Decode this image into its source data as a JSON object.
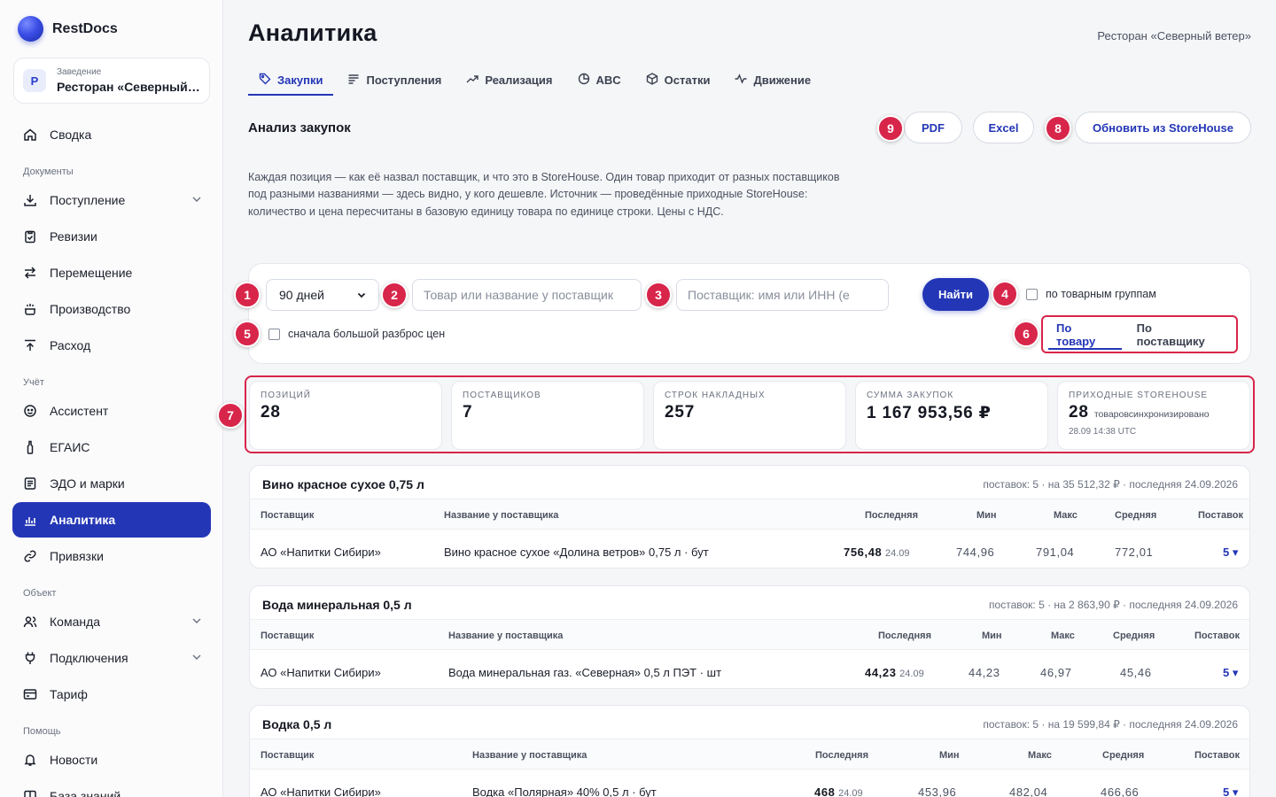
{
  "app": {
    "name": "RestDocs"
  },
  "venue": {
    "label": "Заведение",
    "name": "Ресторан «Северный ветер»",
    "avatar": "Р"
  },
  "sidebar": {
    "items": [
      {
        "label": "Сводка",
        "icon": "home-icon"
      },
      {
        "section": "Документы"
      },
      {
        "label": "Поступление",
        "icon": "download-icon",
        "expandable": true
      },
      {
        "label": "Ревизии",
        "icon": "clipboard-icon"
      },
      {
        "label": "Перемещение",
        "icon": "transfer-icon"
      },
      {
        "label": "Производство",
        "icon": "pot-icon"
      },
      {
        "label": "Расход",
        "icon": "upload-icon"
      },
      {
        "section": "Учёт"
      },
      {
        "label": "Ассистент",
        "icon": "assistant-icon"
      },
      {
        "label": "ЕГАИС",
        "icon": "bottle-icon"
      },
      {
        "label": "ЭДО и марки",
        "icon": "document-icon"
      },
      {
        "label": "Аналитика",
        "icon": "chart-icon",
        "active": true
      },
      {
        "label": "Привязки",
        "icon": "link-icon"
      },
      {
        "section": "Объект"
      },
      {
        "label": "Команда",
        "icon": "users-icon",
        "expandable": true
      },
      {
        "label": "Подключения",
        "icon": "plug-icon",
        "expandable": true
      },
      {
        "label": "Тариф",
        "icon": "card-icon"
      },
      {
        "section": "Помощь"
      },
      {
        "label": "Новости",
        "icon": "bell-icon"
      },
      {
        "label": "База знаний",
        "icon": "book-icon"
      }
    ]
  },
  "header": {
    "title": "Аналитика",
    "venue": "Ресторан «Северный ветер»"
  },
  "tabs": [
    {
      "label": "Закупки",
      "icon": "tag-icon",
      "active": true
    },
    {
      "label": "Поступления",
      "icon": "list-icon"
    },
    {
      "label": "Реализация",
      "icon": "trend-icon"
    },
    {
      "label": "ABC",
      "icon": "pie-icon"
    },
    {
      "label": "Остатки",
      "icon": "box-icon"
    },
    {
      "label": "Движение",
      "icon": "pulse-icon"
    }
  ],
  "section": {
    "title": "Анализ закупок",
    "pdf": "PDF",
    "excel": "Excel",
    "refresh": "Обновить из StoreHouse",
    "description": "Каждая позиция — как её назвал поставщик, и что это в StoreHouse. Один товар приходит от разных поставщиков под разными названиями — здесь видно, у кого дешевле. Источник — проведённые приходные StoreHouse: количество и цена пересчитаны в базовую единицу товара по единице строки. Цены с НДС."
  },
  "filters": {
    "period": "90 дней",
    "product_placeholder": "Товар или название у поставщик",
    "supplier_placeholder": "Поставщик: имя или ИНН (е",
    "find": "Найти",
    "by_groups": "по товарным группам",
    "spread_first": "сначала большой разброс цен",
    "view_by_product": "По товару",
    "view_by_supplier": "По поставщику"
  },
  "badges": [
    "1",
    "2",
    "3",
    "4",
    "5",
    "6",
    "7",
    "8",
    "9"
  ],
  "kpis": [
    {
      "label": "Позиций",
      "value": "28"
    },
    {
      "label": "Поставщиков",
      "value": "7"
    },
    {
      "label": "Строк накладных",
      "value": "257"
    },
    {
      "label": "Сумма закупок",
      "value": "1 167 953,56 ₽"
    },
    {
      "label": "Приходные StoreHouse",
      "value": "28",
      "suffix": "товаровсинхронизировано",
      "time": "28.09 14:38 UTC"
    }
  ],
  "columns": {
    "supplier": "Поставщик",
    "name": "Название у поставщика",
    "last": "Последняя",
    "min": "Мин",
    "max": "Макс",
    "avg": "Средняя",
    "deliveries": "Поставок"
  },
  "products": [
    {
      "title": "Вино красное сухое 0,75 л",
      "meta": "поставок: 5 · на 35 512,32 ₽ · последняя 24.09.2026",
      "row": {
        "supplier": "АО «Напитки Сибири»",
        "name": "Вино красное сухое «Долина ветров» 0,75 л · бут",
        "last": "756,48",
        "last_date": "24.09",
        "min": "744,96",
        "max": "791,04",
        "avg": "772,01",
        "count": "5 ▾"
      }
    },
    {
      "title": "Вода минеральная 0,5 л",
      "meta": "поставок: 5 · на 2 863,90 ₽ · последняя 24.09.2026",
      "row": {
        "supplier": "АО «Напитки Сибири»",
        "name": "Вода минеральная газ. «Северная» 0,5 л ПЭТ · шт",
        "last": "44,23",
        "last_date": "24.09",
        "min": "44,23",
        "max": "46,97",
        "avg": "45,46",
        "count": "5 ▾"
      }
    },
    {
      "title": "Водка 0,5 л",
      "meta": "поставок: 5 · на 19 599,84 ₽ · последняя 24.09.2026",
      "row": {
        "supplier": "АО «Напитки Сибири»",
        "name": "Водка «Полярная» 40% 0,5 л · бут",
        "last": "468",
        "last_date": "24.09",
        "min": "453,96",
        "max": "482,04",
        "avg": "466,66",
        "count": "5 ▾"
      }
    }
  ]
}
